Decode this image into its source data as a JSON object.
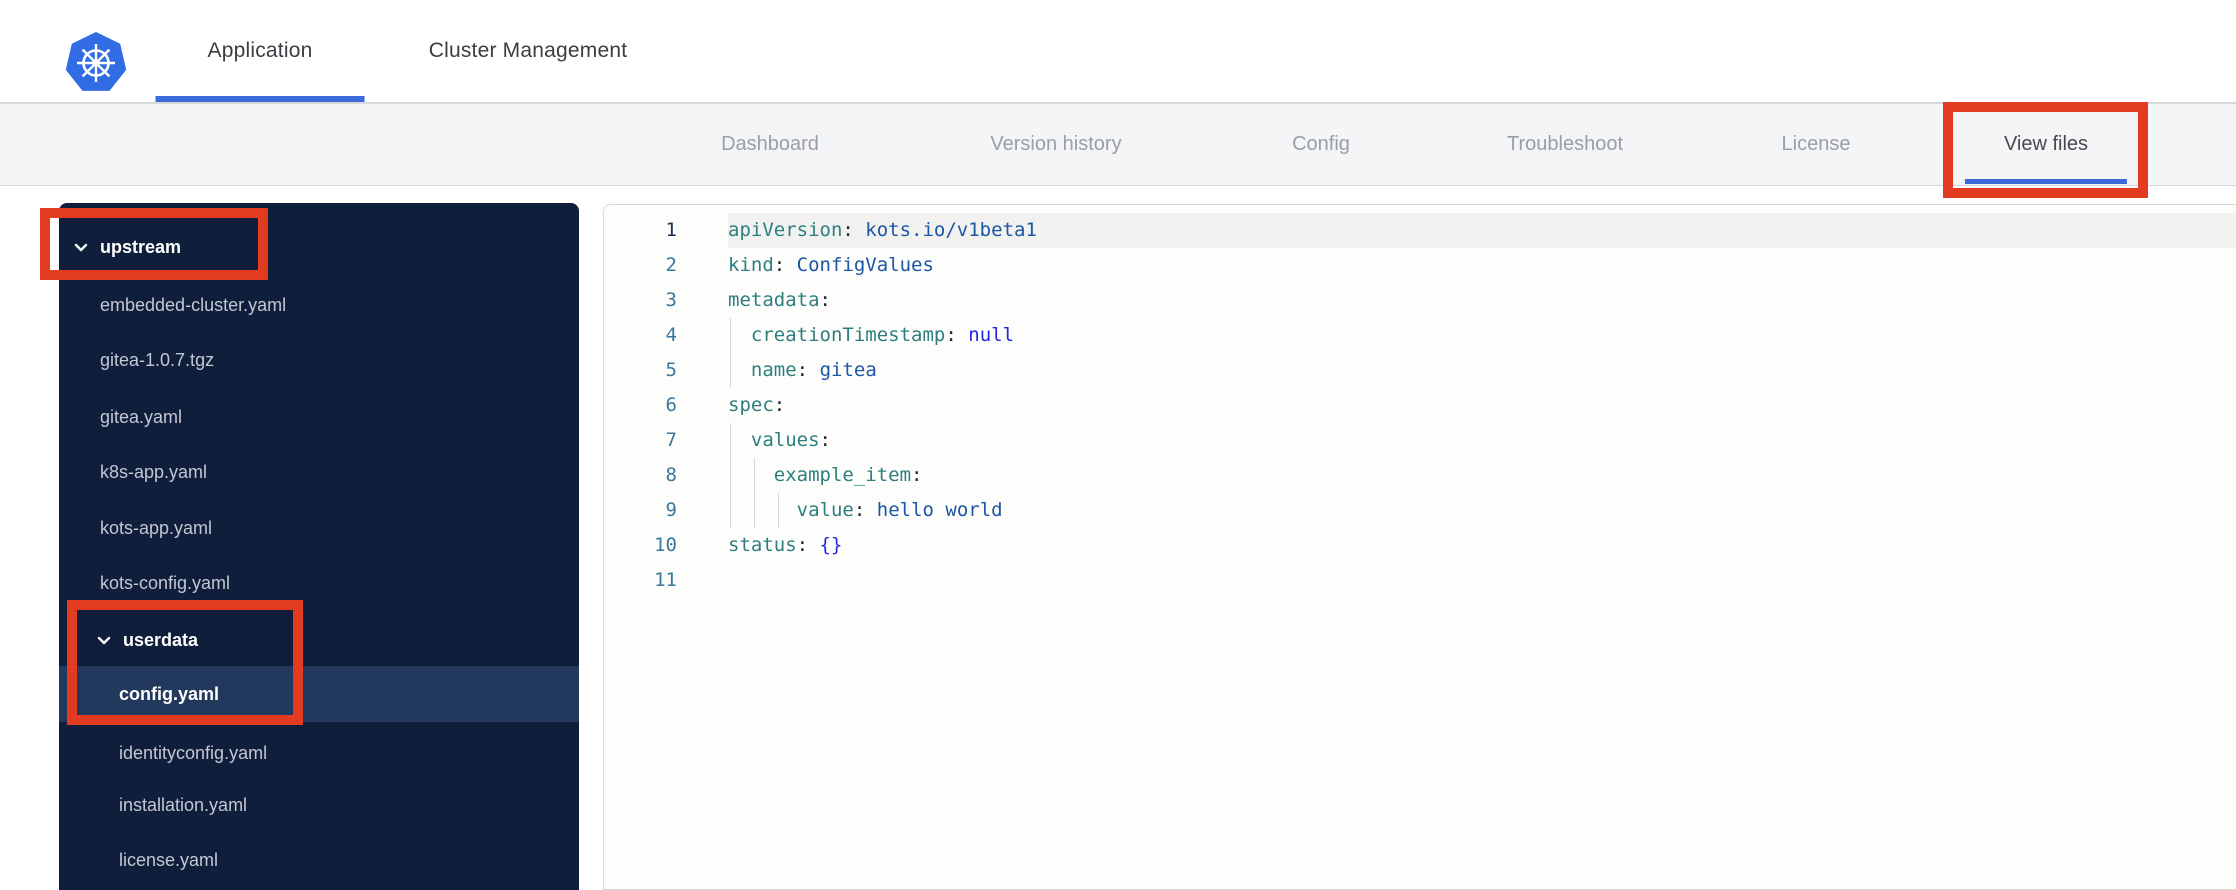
{
  "colors": {
    "accent_blue": "#3c6bd9",
    "annotation_red": "#e23b20",
    "sidebar_bg": "#0f1e3b",
    "sidebar_selected_bg": "#22395d",
    "subnav_bg": "#f4f5f7",
    "code_key": "#2d7f7f",
    "code_value": "#1c56a4",
    "code_keyword": "#2525e6",
    "gutter": "#38789a"
  },
  "header": {
    "logo_icon": "kubernetes-logo",
    "tabs": [
      {
        "label": "Application",
        "active": true
      },
      {
        "label": "Cluster Management",
        "active": false
      }
    ]
  },
  "subnav": {
    "tabs": [
      {
        "label": "Dashboard",
        "active": false
      },
      {
        "label": "Version history",
        "active": false
      },
      {
        "label": "Config",
        "active": false
      },
      {
        "label": "Troubleshoot",
        "active": false
      },
      {
        "label": "License",
        "active": false
      },
      {
        "label": "View files",
        "active": true
      }
    ]
  },
  "file_tree": {
    "items": [
      {
        "label": "upstream",
        "type": "folder",
        "level": 0,
        "expanded": true,
        "selected": false
      },
      {
        "label": "embedded-cluster.yaml",
        "type": "file",
        "level": 1,
        "selected": false
      },
      {
        "label": "gitea-1.0.7.tgz",
        "type": "file",
        "level": 1,
        "selected": false
      },
      {
        "label": "gitea.yaml",
        "type": "file",
        "level": 1,
        "selected": false
      },
      {
        "label": "k8s-app.yaml",
        "type": "file",
        "level": 1,
        "selected": false
      },
      {
        "label": "kots-app.yaml",
        "type": "file",
        "level": 1,
        "selected": false
      },
      {
        "label": "kots-config.yaml",
        "type": "file",
        "level": 1,
        "selected": false
      },
      {
        "label": "userdata",
        "type": "folder",
        "level": 1,
        "expanded": true,
        "selected": false
      },
      {
        "label": "config.yaml",
        "type": "file",
        "level": 2,
        "selected": true
      },
      {
        "label": "identityconfig.yaml",
        "type": "file",
        "level": 2,
        "selected": false
      },
      {
        "label": "installation.yaml",
        "type": "file",
        "level": 2,
        "selected": false
      },
      {
        "label": "license.yaml",
        "type": "file",
        "level": 2,
        "selected": false
      }
    ]
  },
  "editor": {
    "language": "yaml",
    "active_line": 1,
    "lines": [
      {
        "num": "1",
        "segments": [
          [
            "k",
            "apiVersion"
          ],
          [
            "p",
            ":"
          ],
          [
            "t",
            " "
          ],
          [
            "v",
            "kots.io/v1beta1"
          ]
        ]
      },
      {
        "num": "2",
        "segments": [
          [
            "k",
            "kind"
          ],
          [
            "p",
            ":"
          ],
          [
            "t",
            " "
          ],
          [
            "v",
            "ConfigValues"
          ]
        ]
      },
      {
        "num": "3",
        "segments": [
          [
            "k",
            "metadata"
          ],
          [
            "p",
            ":"
          ]
        ]
      },
      {
        "num": "4",
        "segments": [
          [
            "t",
            "  "
          ],
          [
            "k",
            "creationTimestamp"
          ],
          [
            "p",
            ":"
          ],
          [
            "t",
            " "
          ],
          [
            "kw",
            "null"
          ]
        ]
      },
      {
        "num": "5",
        "segments": [
          [
            "t",
            "  "
          ],
          [
            "k",
            "name"
          ],
          [
            "p",
            ":"
          ],
          [
            "t",
            " "
          ],
          [
            "v",
            "gitea"
          ]
        ]
      },
      {
        "num": "6",
        "segments": [
          [
            "k",
            "spec"
          ],
          [
            "p",
            ":"
          ]
        ]
      },
      {
        "num": "7",
        "segments": [
          [
            "t",
            "  "
          ],
          [
            "k",
            "values"
          ],
          [
            "p",
            ":"
          ]
        ]
      },
      {
        "num": "8",
        "segments": [
          [
            "t",
            "    "
          ],
          [
            "k",
            "example_item"
          ],
          [
            "p",
            ":"
          ]
        ]
      },
      {
        "num": "9",
        "segments": [
          [
            "t",
            "      "
          ],
          [
            "k",
            "value"
          ],
          [
            "p",
            ":"
          ],
          [
            "t",
            " "
          ],
          [
            "v",
            "hello world"
          ]
        ]
      },
      {
        "num": "10",
        "segments": [
          [
            "k",
            "status"
          ],
          [
            "p",
            ":"
          ],
          [
            "t",
            " "
          ],
          [
            "kw",
            "{}"
          ]
        ]
      },
      {
        "num": "11",
        "segments": []
      }
    ]
  },
  "annotations": [
    {
      "target": "upstream-folder"
    },
    {
      "target": "userdata-folder-and-config-yaml"
    },
    {
      "target": "view-files-tab"
    }
  ]
}
